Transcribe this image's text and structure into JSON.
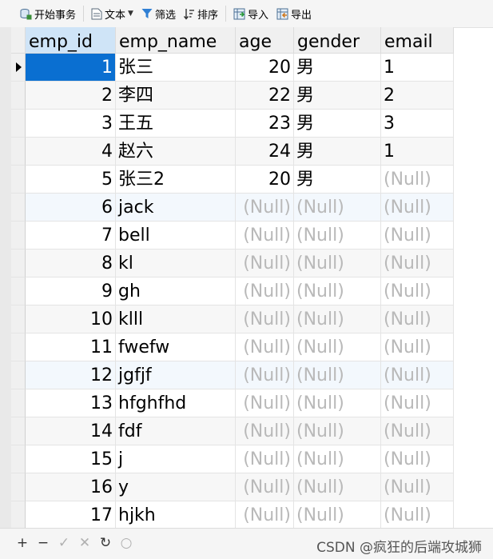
{
  "toolbar": {
    "begin_transaction": "开始事务",
    "text": "文本",
    "filter": "筛选",
    "sort": "排序",
    "import": "导入",
    "export": "导出"
  },
  "table": {
    "columns": [
      "emp_id",
      "emp_name",
      "age",
      "gender",
      "email"
    ],
    "rows": [
      {
        "emp_id": "1",
        "emp_name": "张三",
        "age": "20",
        "gender": "男",
        "email": "1"
      },
      {
        "emp_id": "2",
        "emp_name": "李四",
        "age": "22",
        "gender": "男",
        "email": "2"
      },
      {
        "emp_id": "3",
        "emp_name": "王五",
        "age": "23",
        "gender": "男",
        "email": "3"
      },
      {
        "emp_id": "4",
        "emp_name": "赵六",
        "age": "24",
        "gender": "男",
        "email": "1"
      },
      {
        "emp_id": "5",
        "emp_name": "张三2",
        "age": "20",
        "gender": "男",
        "email": "(Null)"
      },
      {
        "emp_id": "6",
        "emp_name": "jack",
        "age": "(Null)",
        "gender": "(Null)",
        "email": "(Null)"
      },
      {
        "emp_id": "7",
        "emp_name": "bell",
        "age": "(Null)",
        "gender": "(Null)",
        "email": "(Null)"
      },
      {
        "emp_id": "8",
        "emp_name": "kl",
        "age": "(Null)",
        "gender": "(Null)",
        "email": "(Null)"
      },
      {
        "emp_id": "9",
        "emp_name": "gh",
        "age": "(Null)",
        "gender": "(Null)",
        "email": "(Null)"
      },
      {
        "emp_id": "10",
        "emp_name": "klll",
        "age": "(Null)",
        "gender": "(Null)",
        "email": "(Null)"
      },
      {
        "emp_id": "11",
        "emp_name": "fwefw",
        "age": "(Null)",
        "gender": "(Null)",
        "email": "(Null)"
      },
      {
        "emp_id": "12",
        "emp_name": "jgfjf",
        "age": "(Null)",
        "gender": "(Null)",
        "email": "(Null)"
      },
      {
        "emp_id": "13",
        "emp_name": "hfghfhd",
        "age": "(Null)",
        "gender": "(Null)",
        "email": "(Null)"
      },
      {
        "emp_id": "14",
        "emp_name": "fdf",
        "age": "(Null)",
        "gender": "(Null)",
        "email": "(Null)"
      },
      {
        "emp_id": "15",
        "emp_name": "j",
        "age": "(Null)",
        "gender": "(Null)",
        "email": "(Null)"
      },
      {
        "emp_id": "16",
        "emp_name": "y",
        "age": "(Null)",
        "gender": "(Null)",
        "email": "(Null)"
      },
      {
        "emp_id": "17",
        "emp_name": "hjkh",
        "age": "(Null)",
        "gender": "(Null)",
        "email": "(Null)"
      }
    ]
  },
  "bottom_bar": {
    "icons": [
      "add-record-icon",
      "delete-record-icon",
      "apply-icon",
      "discard-icon",
      "refresh-icon",
      "stop-icon"
    ],
    "watermark": "CSDN @疯狂的后端攻城狮"
  },
  "colors": {
    "selection": "#0a6fd1",
    "header_active": "#cfe4f7",
    "null_text": "#b9b9b9"
  }
}
